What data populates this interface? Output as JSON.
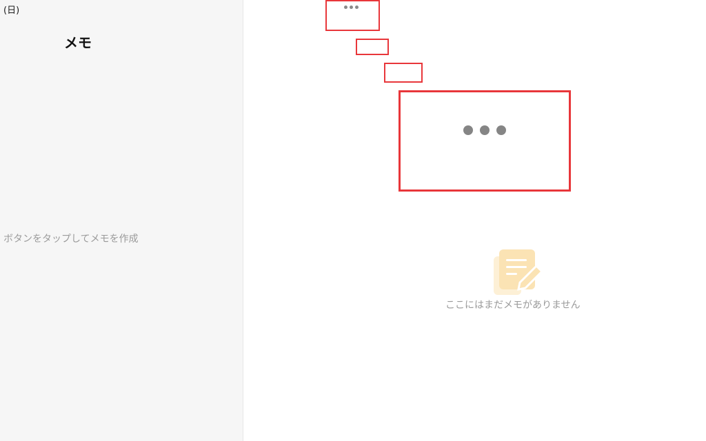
{
  "sidebar": {
    "date": "(日)",
    "title": "メモ",
    "hint": "ボタンをタップしてメモを作成"
  },
  "main": {
    "empty_message": "ここにはまだメモがありません"
  },
  "icons": {
    "more_small": "more-dots-icon",
    "more_large": "more-dots-icon",
    "empty_state": "memo-note-icon"
  },
  "colors": {
    "highlight": "#e8363a",
    "sidebar_bg": "#f6f6f6",
    "icon_fill": "#fbe3b4"
  }
}
